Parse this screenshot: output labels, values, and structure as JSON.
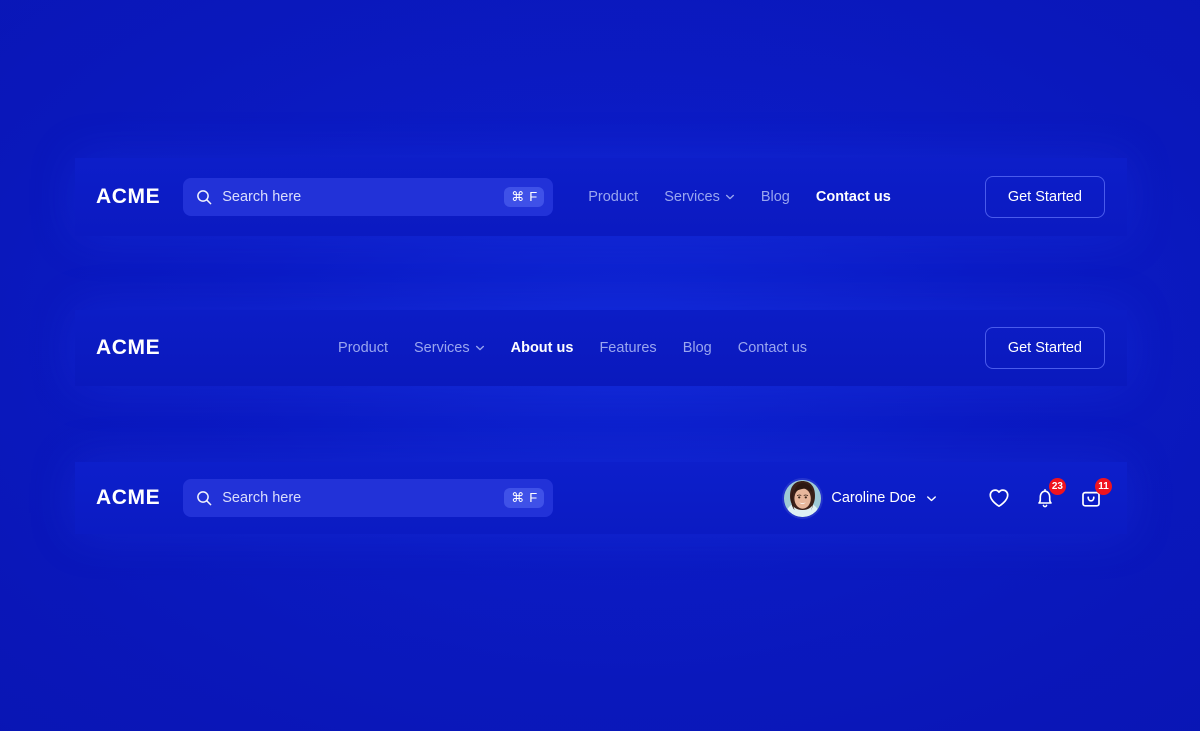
{
  "theme": {
    "page_background": "#0a18bc",
    "bar_background": "#0b1bc2",
    "search_field": "#2232d8",
    "kbd_badge": "#3f51e8",
    "accent_text": "#ffffff",
    "muted_text": "#9aa6ef",
    "badge_red": "#f0131e"
  },
  "navbars": [
    {
      "id": "navbar-search-links-cta",
      "brand": "ACME",
      "search": {
        "placeholder": "Search here",
        "value": "",
        "shortcut_symbol": "⌘",
        "shortcut_key": "F",
        "icon": "search-icon"
      },
      "links": [
        {
          "label": "Product",
          "active": false,
          "has_dropdown": false
        },
        {
          "label": "Services",
          "active": false,
          "has_dropdown": true
        },
        {
          "label": "Blog",
          "active": false,
          "has_dropdown": false
        },
        {
          "label": "Contact us",
          "active": true,
          "has_dropdown": false
        }
      ],
      "cta": "Get Started"
    },
    {
      "id": "navbar-centered-links-cta",
      "brand": "ACME",
      "links": [
        {
          "label": "Product",
          "active": false,
          "has_dropdown": false
        },
        {
          "label": "Services",
          "active": false,
          "has_dropdown": true
        },
        {
          "label": "About us",
          "active": true,
          "has_dropdown": false
        },
        {
          "label": "Features",
          "active": false,
          "has_dropdown": false
        },
        {
          "label": "Blog",
          "active": false,
          "has_dropdown": false
        },
        {
          "label": "Contact us",
          "active": false,
          "has_dropdown": false
        }
      ],
      "cta": "Get Started"
    },
    {
      "id": "navbar-search-account-icons",
      "brand": "ACME",
      "search": {
        "placeholder": "Search here",
        "value": "",
        "shortcut_symbol": "⌘",
        "shortcut_key": "F",
        "icon": "search-icon"
      },
      "account": {
        "name": "Caroline Doe",
        "avatar": "user-avatar-photo",
        "caret": "chevron-down-icon"
      },
      "icons": [
        {
          "name": "heart-icon",
          "badge": null
        },
        {
          "name": "bell-icon",
          "badge": "23"
        },
        {
          "name": "shopping-bag-icon",
          "badge": "11"
        }
      ]
    }
  ]
}
